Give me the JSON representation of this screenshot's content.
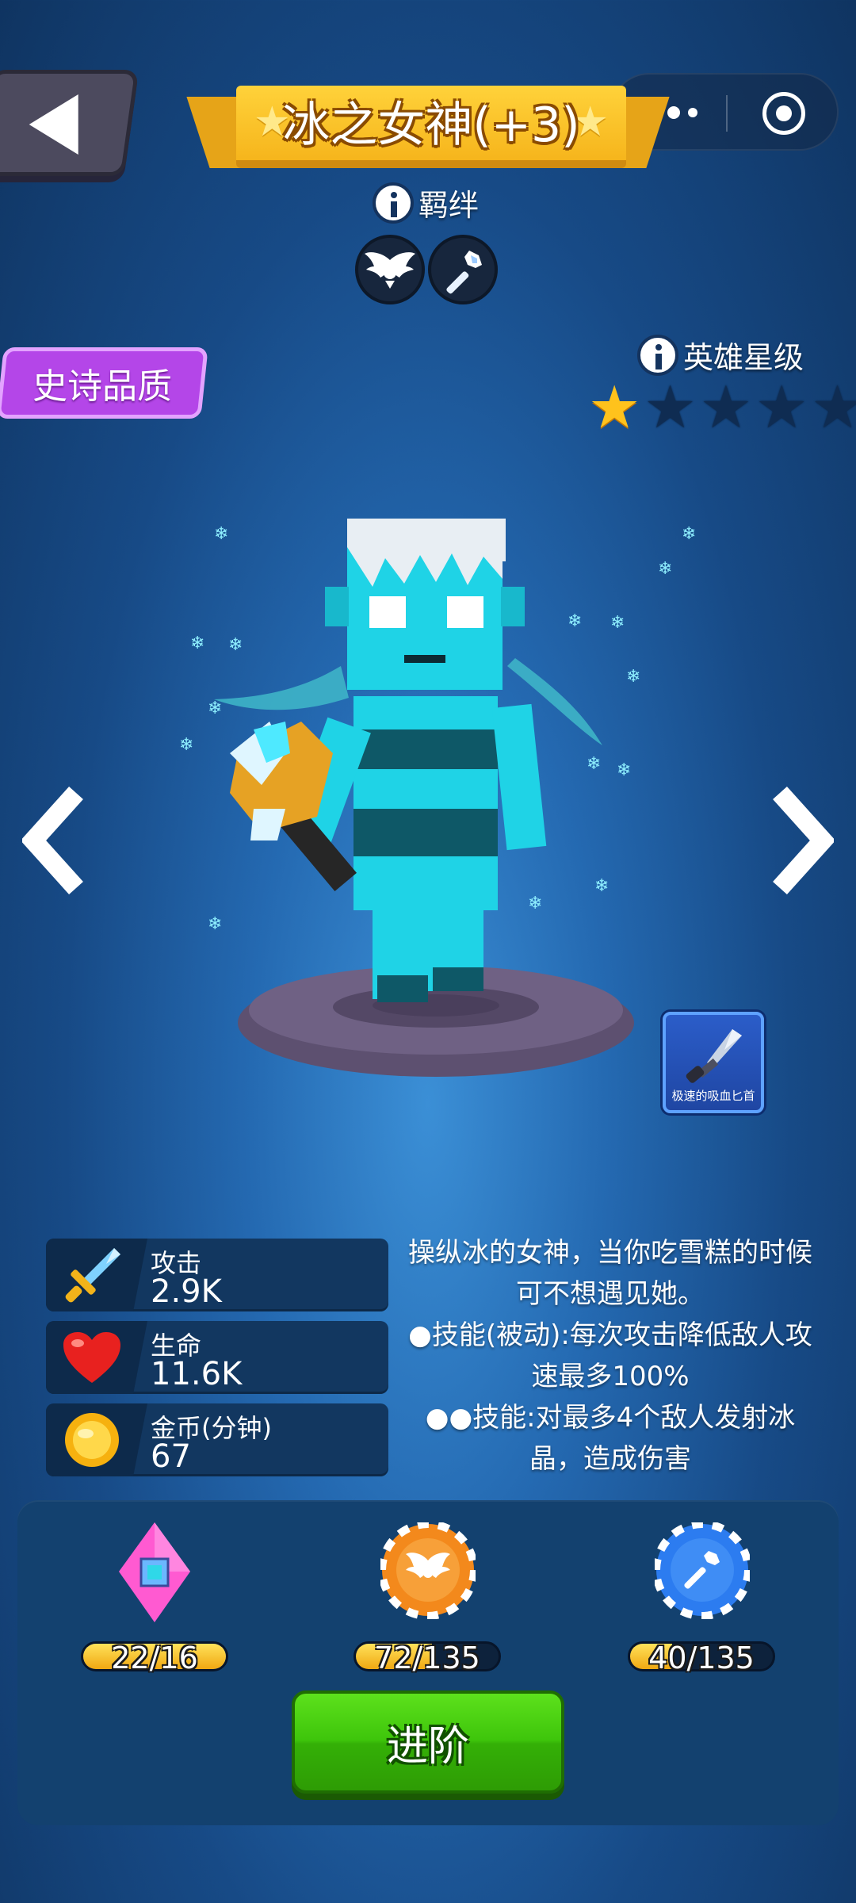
{
  "hero": {
    "name": "冰之女神(+3)",
    "quality": "史诗品质",
    "star_label": "英雄星级",
    "stars_filled": 1,
    "stars_total": 5
  },
  "bond": {
    "label": "羁绊",
    "icons": [
      "wings-emblem-icon",
      "ice-wand-icon"
    ]
  },
  "weapon": {
    "label": "极速的吸血匕首",
    "icon": "dagger-icon"
  },
  "stats": [
    {
      "name": "攻击",
      "value": "2.9K",
      "icon": "sword-icon"
    },
    {
      "name": "生命",
      "value": "11.6K",
      "icon": "heart-icon"
    },
    {
      "name": "金币(分钟)",
      "value": "67",
      "icon": "coin-icon"
    }
  ],
  "description": [
    "操纵冰的女神，当你吃雪糕的时候可不想遇见她。",
    "●技能(被动):每次攻击降低敌人攻速最多100%",
    "●●技能:对最多4个敌人发射冰晶，造成伤害"
  ],
  "resources": [
    {
      "icon": "hero-shard-icon",
      "current": 22,
      "required": 16,
      "text": "22/16"
    },
    {
      "icon": "wings-token-icon",
      "current": 72,
      "required": 135,
      "text": "72/135"
    },
    {
      "icon": "wand-token-icon",
      "current": 40,
      "required": 135,
      "text": "40/135"
    }
  ],
  "advance_label": "进阶",
  "colors": {
    "ribbon": "#f6b51c",
    "epic": "#b446e8",
    "star_on": "#ffc21c",
    "advance_button": "#3ec50b",
    "resource_fill": "#f0a812"
  }
}
